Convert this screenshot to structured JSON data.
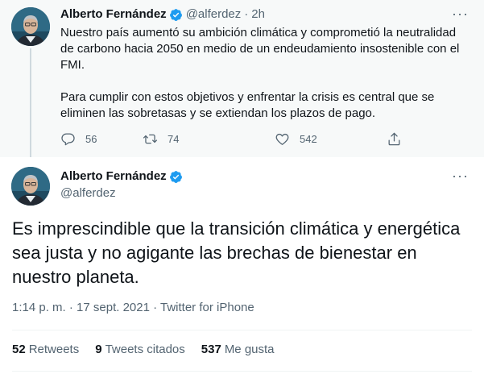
{
  "colors": {
    "verified": "#1d9bf0",
    "secondary_text": "#536471",
    "parent_bg": "#f7f9f9",
    "thread_line": "#cfd9de"
  },
  "parent_tweet": {
    "author_name": "Alberto Fernández",
    "handle": "@alferdez",
    "separator": "·",
    "time": "2h",
    "more_icon": "more-dots-icon",
    "paragraph_1": "Nuestro país aumentó su ambición climática y comprometió la neutralidad de carbono hacia 2050 en medio de un endeudamiento insostenible con el FMI.",
    "paragraph_2": "Para cumplir con estos objetivos y enfrentar la crisis es central que se eliminen las sobretasas y se extiendan los plazos de pago.",
    "actions": {
      "reply_icon": "reply-icon",
      "reply_count": "56",
      "retweet_icon": "retweet-icon",
      "retweet_count": "74",
      "like_icon": "heart-icon",
      "like_count": "542",
      "share_icon": "share-icon"
    }
  },
  "main_tweet": {
    "author_name": "Alberto Fernández",
    "handle": "@alferdez",
    "more_icon": "more-dots-icon",
    "text": "Es imprescindible que la transición climática y energética sea justa y no agigante las brechas de bienestar en nuestro planeta.",
    "meta": "1:14 p. m. · 17 sept. 2021 · Twitter for iPhone",
    "stats": {
      "retweets_count": "52",
      "retweets_label": "Retweets",
      "quotes_count": "9",
      "quotes_label": "Tweets citados",
      "likes_count": "537",
      "likes_label": "Me gusta"
    }
  }
}
